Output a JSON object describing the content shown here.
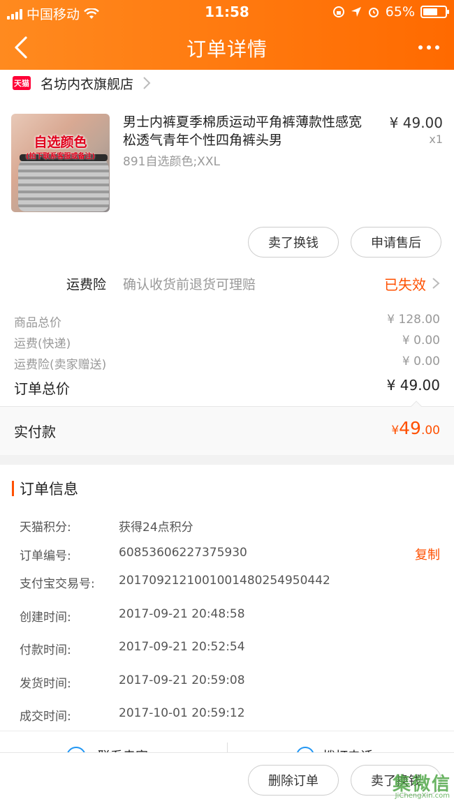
{
  "status_bar": {
    "carrier": "中国移动",
    "time": "11:58",
    "battery": "65%"
  },
  "nav": {
    "title": "订单详情"
  },
  "shop": {
    "badge": "天猫",
    "name": "名坊内衣旗舰店"
  },
  "product": {
    "image_caption": "自选颜色",
    "image_subcaption": "(拍下联系客服或备注)",
    "title": "男士内裤夏季棉质运动平角裤薄款性感宽松透气青年个性四角裤头男",
    "sku": "891自选颜色;XXL",
    "price": "¥ 49.00",
    "qty": "x1"
  },
  "actions": {
    "sell_label": "卖了换钱",
    "aftersale_label": "申请售后"
  },
  "insurance": {
    "label": "运费险",
    "desc": "确认收货前退货可理赔",
    "status": "已失效"
  },
  "prices": {
    "goods_label": "商品总价",
    "goods_value": "¥ 128.00",
    "shipping_label": "运费(快递)",
    "shipping_value": "¥ 0.00",
    "ins_label": "运费险(卖家赠送)",
    "ins_value": "¥ 0.00",
    "total_label": "订单总价",
    "total_value": "¥ 49.00",
    "paid_label": "实付款",
    "paid_currency": "¥",
    "paid_int": "49",
    "paid_dec": ".00"
  },
  "order_info": {
    "title": "订单信息",
    "rows": [
      {
        "key": "天猫积分:",
        "value": "获得24点积分"
      },
      {
        "key": "订单编号:",
        "value": "60853606227375930"
      },
      {
        "key": "支付宝交易号:",
        "value": "2017092121001001480254950442"
      },
      {
        "key": "创建时间:",
        "value": "2017-09-21 20:48:58"
      },
      {
        "key": "付款时间:",
        "value": "2017-09-21 20:52:54"
      },
      {
        "key": "发货时间:",
        "value": "2017-09-21 20:59:08"
      },
      {
        "key": "成交时间:",
        "value": "2017-10-01 20:59:12"
      }
    ],
    "copy_label": "复制"
  },
  "contact": {
    "left_label": "联系卖家",
    "right_label": "拨打电话"
  },
  "bottom": {
    "delete_label": "删除订单",
    "sell_label": "卖了换钱"
  },
  "watermark": {
    "main": "集微信",
    "sub": "JiChengXin.com"
  },
  "colors": {
    "accent": "#ff5000",
    "header_start": "#ff8a1f",
    "header_end": "#ff6a00",
    "tmall_red": "#ff0036"
  }
}
